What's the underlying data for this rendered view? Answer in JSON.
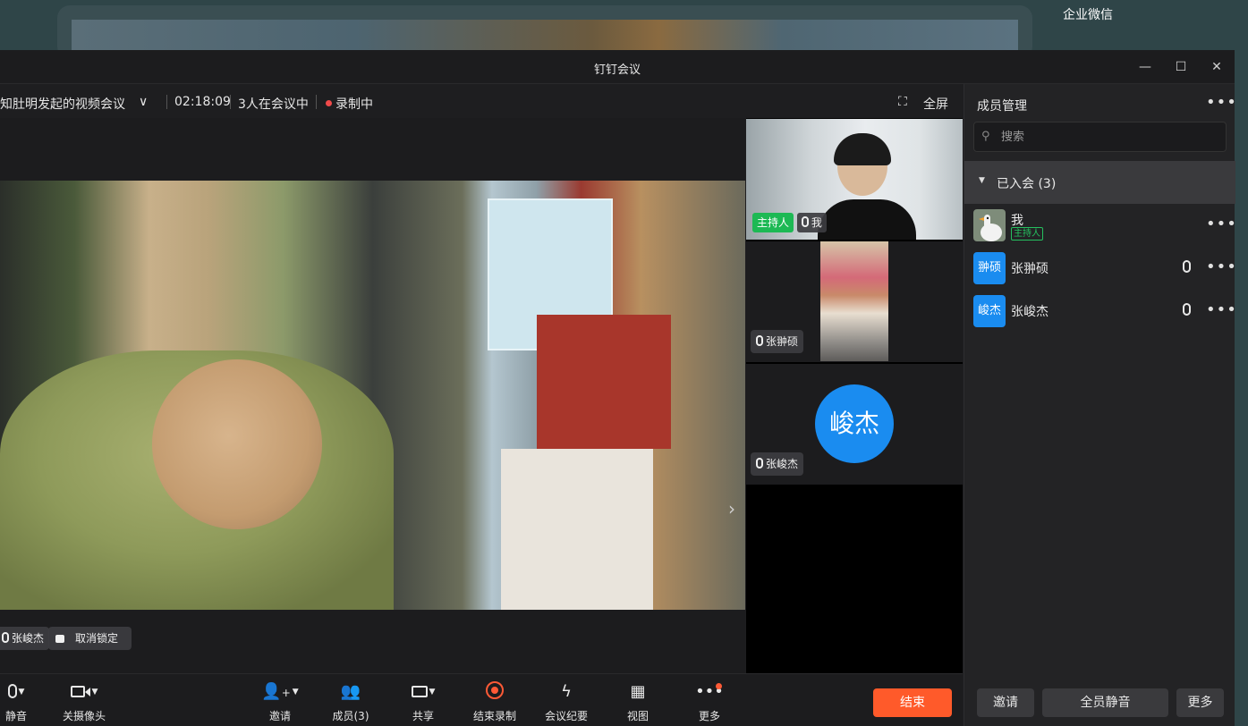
{
  "desktop": {
    "app_label": "企业微信"
  },
  "window": {
    "title": "钉钉会议",
    "minimize_icon": "—",
    "maximize_icon": "☐",
    "close_icon": "✕"
  },
  "infobar": {
    "meeting_name": "知肚明发起的视频会议",
    "dropdown_icon": "∨",
    "duration": "02:18:09",
    "participants_status": "3人在会议中",
    "recording_label": "录制中",
    "fullscreen_label": "全屏",
    "fullscreen_icon": "⛶"
  },
  "stage": {
    "speaker_label": "张峻杰",
    "unlock_label": "取消锁定",
    "next_icon": "›"
  },
  "thumbnails": [
    {
      "host_badge": "主持人",
      "name": "我"
    },
    {
      "name": "张翀硕"
    },
    {
      "name": "张峻杰",
      "avatar_text": "峻杰"
    }
  ],
  "panel": {
    "title": "成员管理",
    "more_icon": "•••",
    "search_placeholder": "搜索",
    "search_icon": "⚲",
    "group_label": "已入会 (3)",
    "members": [
      {
        "name": "我",
        "tag": "主持人",
        "avatar_text": ""
      },
      {
        "name": "张翀硕",
        "avatar_text": "翀硕"
      },
      {
        "name": "张峻杰",
        "avatar_text": "峻杰"
      }
    ],
    "buttons": {
      "invite": "邀请",
      "mute_all": "全员静音",
      "more": "更多"
    }
  },
  "toolbar": {
    "mute": "静音",
    "camera": "关摄像头",
    "invite": "邀请",
    "members": "成员(3)",
    "share": "共享",
    "stop_recording": "结束录制",
    "minutes": "会议纪要",
    "view": "视图",
    "more": "更多",
    "end": "结束"
  },
  "colors": {
    "accent_blue": "#1a8cf0",
    "end_red": "#ff5a2a",
    "host_green": "#25c05f",
    "record_red": "#f04a4a"
  }
}
